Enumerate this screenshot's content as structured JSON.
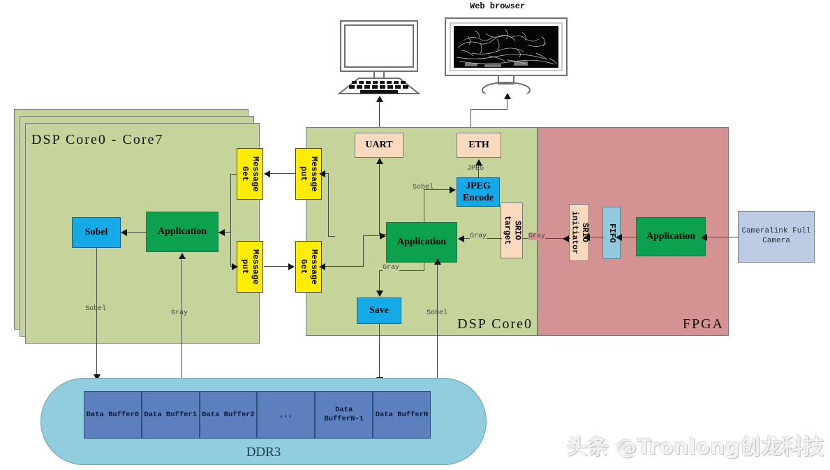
{
  "devices": {
    "web_browser_caption": "Web browser",
    "laptop_name": "laptop-display",
    "monitor_name": "web-browser-monitor"
  },
  "panels": {
    "dsp_multicore": {
      "label": "DSP Core0 - Core7"
    },
    "dsp_core0": {
      "label": "DSP Core0"
    },
    "fpga": {
      "label": "FPGA"
    }
  },
  "nodes": {
    "left_sobel": "Sobel",
    "left_application": "Application",
    "msg_get_left": "Message\nGet",
    "msg_put_left": "Message\nput",
    "msg_put_mid": "Message\nput",
    "msg_get_mid": "Message\nGet",
    "uart": "UART",
    "eth": "ETH",
    "jpeg_encode": "JPEG\nEncode",
    "mid_application": "Application",
    "srio_target": "SRIO\ntarget",
    "save": "Save",
    "srio_initiator": "SRIO\ninitiator",
    "fifo": "FIFO",
    "fpga_application": "Application",
    "camera": "Cameralink Full\nCamera"
  },
  "edge_labels": {
    "jpeg": "JPEG",
    "sobel_to_jpeg": "Sobel",
    "gray_srio_to_app": "Gray",
    "gray_fpga_out": "Gray",
    "gray_to_save": "Gray",
    "sobel_from_ddr": "Sobel",
    "sobel_left_down": "Sobel",
    "gray_left_up": "Gray"
  },
  "ddr3": {
    "label": "DDR3",
    "buffers": [
      "Data Buffer0",
      "Data Buffer1",
      "Data Buffer2",
      ",,,",
      "Data\nBufferN-1",
      "Data BufferN"
    ]
  },
  "watermark": "头条 @Tronlong创龙科技",
  "colors": {
    "panel_dsp": "#c5d49a",
    "panel_fpga": "#d49292",
    "green": "#0ba14f",
    "blue": "#16a9e8",
    "yellow": "#ffec00",
    "peach": "#fbd9bf",
    "light_blue": "#92c9dd",
    "gray_blue": "#bdcce4",
    "ddr_body": "#8fcddf",
    "buffer": "#5b80bd"
  }
}
